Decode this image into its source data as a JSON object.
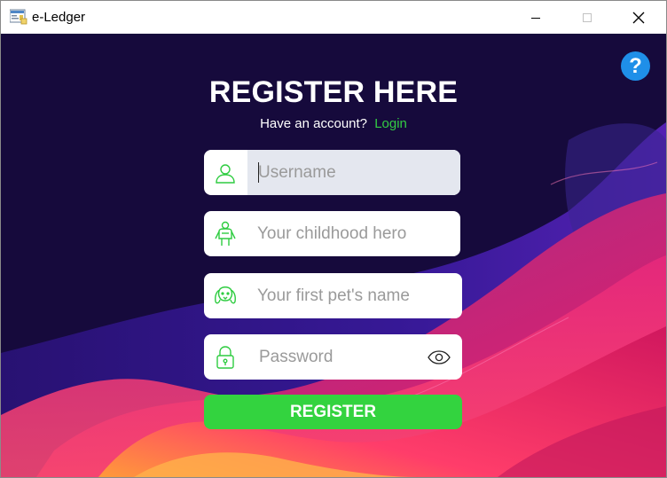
{
  "window": {
    "title": "e-Ledger",
    "icon": "ledger-app-icon",
    "controls": [
      "minimize-icon",
      "maximize-icon",
      "close-icon"
    ]
  },
  "help": {
    "label": "?"
  },
  "form": {
    "heading": "REGISTER HERE",
    "account_prompt": "Have an account?",
    "login_link": "Login",
    "fields": {
      "username": {
        "placeholder": "Username",
        "value": "",
        "icon": "user-icon"
      },
      "hero": {
        "placeholder": "Your childhood hero",
        "value": "",
        "icon": "hero-icon"
      },
      "pet": {
        "placeholder": "Your first pet's name",
        "value": "",
        "icon": "dog-icon"
      },
      "password": {
        "placeholder": "Password",
        "value": "",
        "icon": "lock-icon",
        "toggle_icon": "eye-icon"
      }
    },
    "register_label": "REGISTER"
  },
  "colors": {
    "background": "#160a3c",
    "accent_green": "#33d33f",
    "help_blue": "#1f8fe8",
    "username_field_bg": "#e4e7ef",
    "icon_green": "#2ecc40"
  }
}
